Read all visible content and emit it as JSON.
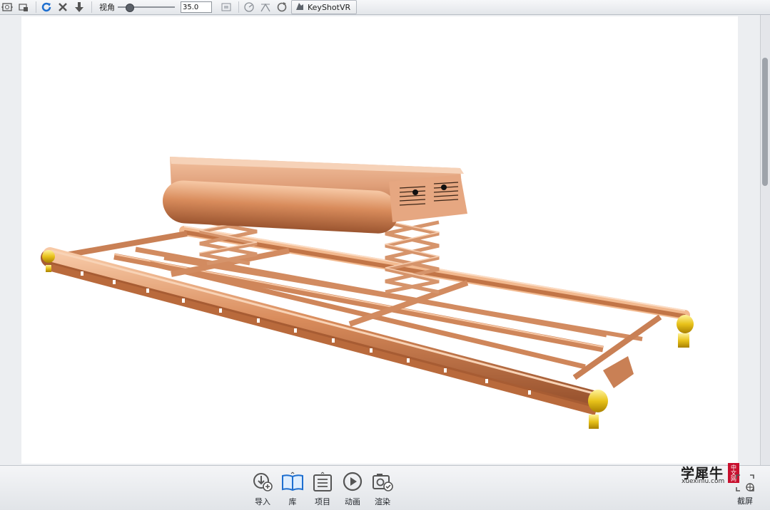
{
  "toolbar": {
    "fov_label": "视角",
    "fov_value": "35.0",
    "vr_label": "KeyShotVR",
    "fov_fraction": 0.15
  },
  "ribbon": {
    "items": [
      {
        "label": "导入",
        "icon": "import-icon"
      },
      {
        "label": "库",
        "icon": "library-icon"
      },
      {
        "label": "项目",
        "icon": "project-icon"
      },
      {
        "label": "动画",
        "icon": "animation-icon"
      },
      {
        "label": "渲染",
        "icon": "render-icon"
      }
    ]
  },
  "capture": {
    "label": "截屏",
    "icon": "screenshot-icon"
  },
  "watermark": {
    "cn": "学犀牛",
    "en": "xuexiniu.com",
    "badge": "中文网"
  },
  "colors": {
    "accent": "#1e6fd0",
    "copper": "#d08a5e",
    "gold": "#e8c21a"
  }
}
